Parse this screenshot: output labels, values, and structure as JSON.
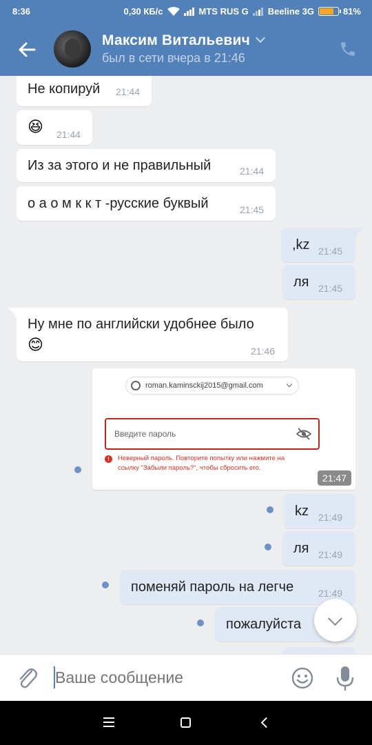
{
  "status_bar": {
    "time": "8:36",
    "net_speed": "0,30 КБ/с",
    "carrier1": "MTS RUS G",
    "carrier2": "Beeline 3G",
    "battery": "81%",
    "battery_level": 0.81
  },
  "header": {
    "contact_name": "Максим Витальевич",
    "last_seen": "был в сети вчера в 21:46"
  },
  "messages": [
    {
      "dir": "in",
      "text": "Не копируй",
      "time": "21:44"
    },
    {
      "dir": "in",
      "emoji": "😆",
      "time": "21:44"
    },
    {
      "dir": "in",
      "text": "Из за этого и не правильный",
      "time": "21:44"
    },
    {
      "dir": "in",
      "text": "о а о м к к т -русские буквый",
      "time": "21:45"
    },
    {
      "dir": "out",
      "text": ",kz",
      "time": "21:45"
    },
    {
      "dir": "out",
      "text": "ля",
      "time": "21:45"
    },
    {
      "dir": "in",
      "text": "Ну мне по английски удобнее было",
      "emoji": "😊",
      "time": "21:46"
    },
    {
      "dir": "out",
      "type": "image",
      "time": "21:47",
      "image": {
        "account": "roman.kaminsckij2015@gmail.com",
        "placeholder": "Введите пароль",
        "error_line1": "Неверный пароль. Повторите попытку или нажмите на",
        "error_line2": "ссылку \"Забыли пароль?\", чтобы сбросить его."
      }
    },
    {
      "dir": "out",
      "text": "kz",
      "time": "21:49"
    },
    {
      "dir": "out",
      "text": "ля",
      "time": "21:49"
    },
    {
      "dir": "out",
      "text": "поменяй пароль на легче",
      "time": "21:49"
    },
    {
      "dir": "out",
      "text": "пожалуйста",
      "time": ""
    }
  ],
  "composer": {
    "placeholder": "Ваше сообщение"
  },
  "colors": {
    "header": "#5181b8",
    "incoming_bubble": "#ffffff",
    "outgoing_bubble": "#dfe8f4",
    "unread_dot": "#6d93c4",
    "error_red": "#d93025"
  }
}
